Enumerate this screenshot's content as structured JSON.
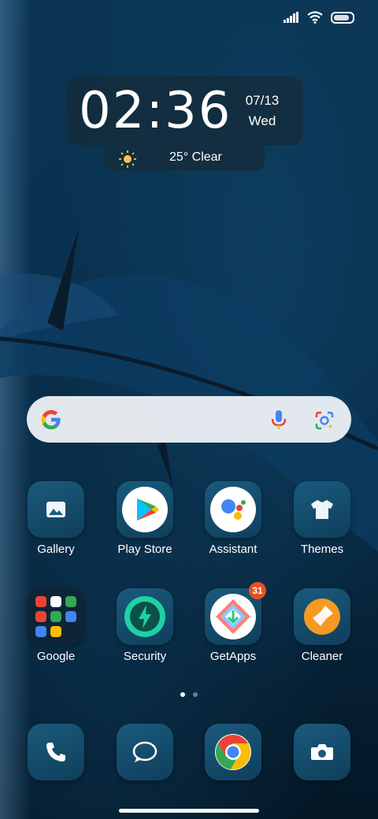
{
  "status": {
    "battery_level": 0.85
  },
  "clock": {
    "time": "02:36",
    "date": "07/13",
    "weekday": "Wed"
  },
  "weather": {
    "text": "25° Clear"
  },
  "search": {
    "mic_icon": "mic-icon",
    "lens_icon": "google-lens-icon"
  },
  "apps": [
    {
      "label": "Gallery"
    },
    {
      "label": "Play Store"
    },
    {
      "label": "Assistant"
    },
    {
      "label": "Themes"
    },
    {
      "label": "Google"
    },
    {
      "label": "Security"
    },
    {
      "label": "GetApps",
      "badge": "31"
    },
    {
      "label": "Cleaner"
    }
  ],
  "pager": {
    "current": 1,
    "total": 2
  },
  "dock": [
    "phone-icon",
    "messages-icon",
    "chrome-icon",
    "camera-icon"
  ],
  "colors": {
    "badge": "#e8501e",
    "tile": "#1a5a7c"
  }
}
